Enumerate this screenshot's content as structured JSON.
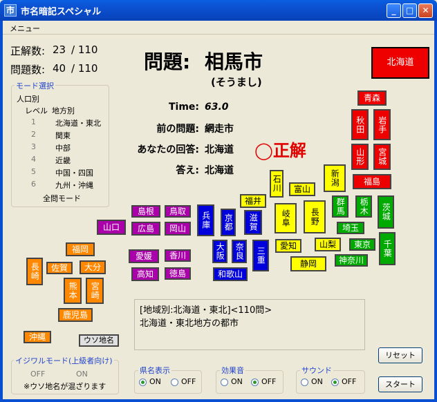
{
  "window": {
    "title": "市名暗記スペシャル",
    "icon": "市"
  },
  "menu": {
    "label": "メニュー"
  },
  "stats": {
    "correct_label": "正解数:",
    "correct": "23",
    "correct_total": "/ 110",
    "questions_label": "問題数:",
    "questions": "40",
    "questions_total": "/ 110"
  },
  "mode_select": {
    "title": "モード選択",
    "population": "人口別",
    "level_header": "レベル",
    "region_header": "地方別",
    "levels": [
      "1",
      "2",
      "3",
      "4",
      "5",
      "6"
    ],
    "regions": [
      "北海道・東北",
      "関東",
      "中部",
      "近畿",
      "中国・四国",
      "九州・沖縄"
    ],
    "all_mode": "全問モード"
  },
  "question": {
    "label": "問題:",
    "city": "相馬市",
    "reading": "(そうまし)",
    "time_label": "Time:",
    "time": "63.0",
    "prev_label": "前の問題:",
    "prev": "網走市",
    "your_label": "あなたの回答:",
    "your": "北海道",
    "answer_label": "答え:",
    "answer": "北海道",
    "result": "◯正解"
  },
  "answer_button": "北海道",
  "prefectures": {
    "aomori": "青森",
    "akita": "秋田",
    "iwate": "岩手",
    "yamagata": "山形",
    "miyagi": "宮城",
    "fukushima": "福島",
    "niigata": "新潟",
    "ishikawa": "石川",
    "toyama": "富山",
    "fukui": "福井",
    "gifu": "岐阜",
    "nagano": "長野",
    "gunma": "群馬",
    "tochigi": "栃木",
    "ibaraki": "茨城",
    "saitama": "埼玉",
    "chiba": "千葉",
    "tokyo": "東京",
    "yamanashi": "山梨",
    "kanagawa": "神奈川",
    "aichi": "愛知",
    "shizuoka": "静岡",
    "shiga": "滋賀",
    "kyoto": "京都",
    "hyogo": "兵庫",
    "osaka": "大阪",
    "nara": "奈良",
    "mie": "三重",
    "wakayama": "和歌山",
    "shimane": "島根",
    "tottori": "鳥取",
    "yamaguchi": "山口",
    "hiroshima": "広島",
    "okayama": "岡山",
    "ehime": "愛媛",
    "kagawa": "香川",
    "kochi": "高知",
    "tokushima": "徳島",
    "fukuoka": "福岡",
    "nagasaki": "長崎",
    "saga": "佐賀",
    "oita": "大分",
    "kumamoto": "熊本",
    "miyazaki": "宮崎",
    "kagoshima": "鹿児島",
    "okinawa": "沖縄",
    "fake": "ウソ地名"
  },
  "description": {
    "line1": "[地域別:北海道・東北]<110問>",
    "line2": "北海道・東北地方の都市"
  },
  "hard_mode": {
    "title": "イジワルモード(上級者向け)",
    "off": "OFF",
    "on": "ON",
    "note": "※ウソ地名が混ざります"
  },
  "pref_display": {
    "title": "県名表示",
    "on": "ON",
    "off": "OFF"
  },
  "sound_effect": {
    "title": "効果音",
    "on": "ON",
    "off": "OFF"
  },
  "sound": {
    "title": "サウンド",
    "on": "ON",
    "off": "OFF"
  },
  "buttons": {
    "reset": "リセット",
    "start": "スタート"
  }
}
